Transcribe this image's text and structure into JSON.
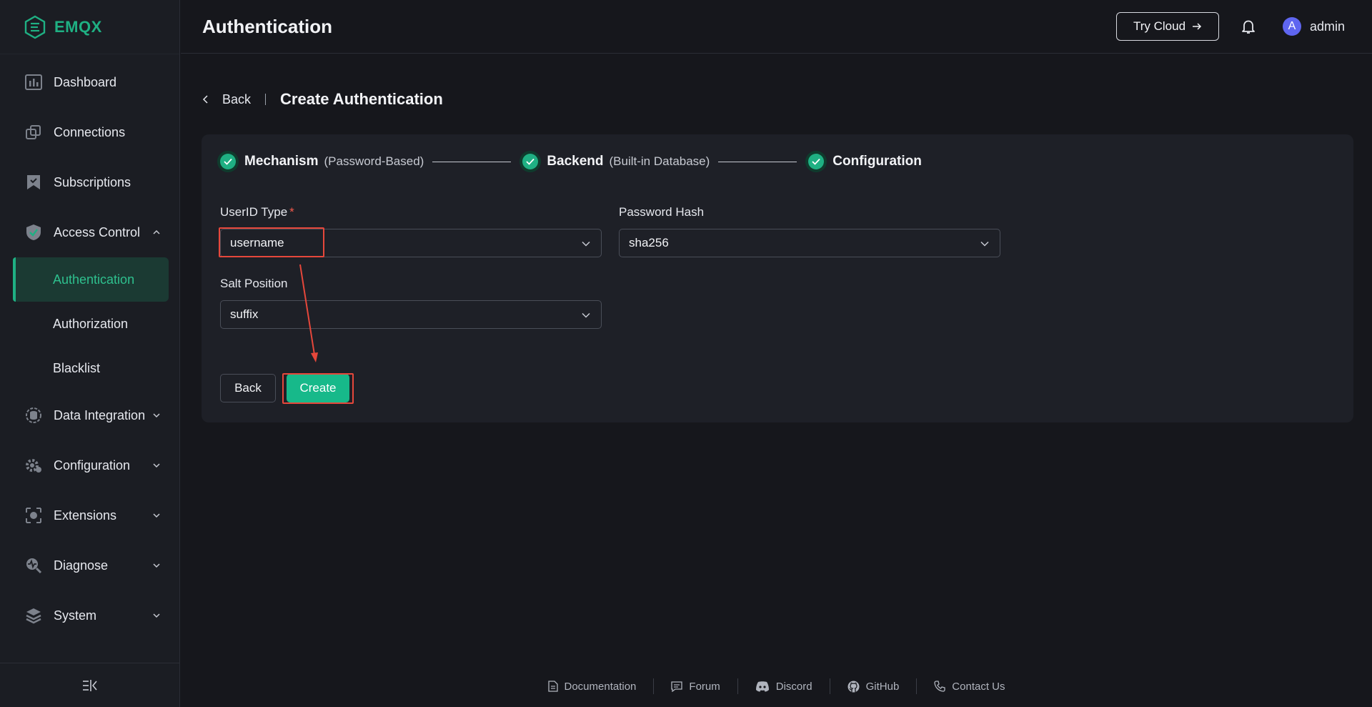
{
  "brand": {
    "name": "EMQX",
    "accent": "#1fb083"
  },
  "sidebar": {
    "items": [
      {
        "label": "Dashboard",
        "icon": "dashboard-icon"
      },
      {
        "label": "Connections",
        "icon": "connections-icon"
      },
      {
        "label": "Subscriptions",
        "icon": "subscriptions-icon"
      },
      {
        "label": "Access Control",
        "icon": "access-control-icon",
        "expanded": true,
        "children": [
          {
            "label": "Authentication",
            "active": true
          },
          {
            "label": "Authorization"
          },
          {
            "label": "Blacklist"
          }
        ]
      },
      {
        "label": "Data Integration",
        "icon": "data-integration-icon"
      },
      {
        "label": "Configuration",
        "icon": "configuration-icon"
      },
      {
        "label": "Extensions",
        "icon": "extensions-icon"
      },
      {
        "label": "Diagnose",
        "icon": "diagnose-icon"
      },
      {
        "label": "System",
        "icon": "system-icon"
      }
    ],
    "collapse_icon": "collapse-sidebar-icon"
  },
  "header": {
    "title": "Authentication",
    "try_cloud": "Try Cloud",
    "avatar_letter": "A",
    "username": "admin"
  },
  "page": {
    "back": "Back",
    "title": "Create Authentication"
  },
  "steps": [
    {
      "name": "Mechanism",
      "detail": "(Password-Based)"
    },
    {
      "name": "Backend",
      "detail": "(Built-in Database)"
    },
    {
      "name": "Configuration",
      "detail": ""
    }
  ],
  "form": {
    "userid_type": {
      "label": "UserID Type",
      "required_mark": "*",
      "value": "username"
    },
    "password_hash": {
      "label": "Password Hash",
      "value": "sha256"
    },
    "salt_position": {
      "label": "Salt Position",
      "value": "suffix"
    },
    "back_button": "Back",
    "create_button": "Create"
  },
  "footer": {
    "links": [
      "Documentation",
      "Forum",
      "Discord",
      "GitHub",
      "Contact Us"
    ]
  }
}
